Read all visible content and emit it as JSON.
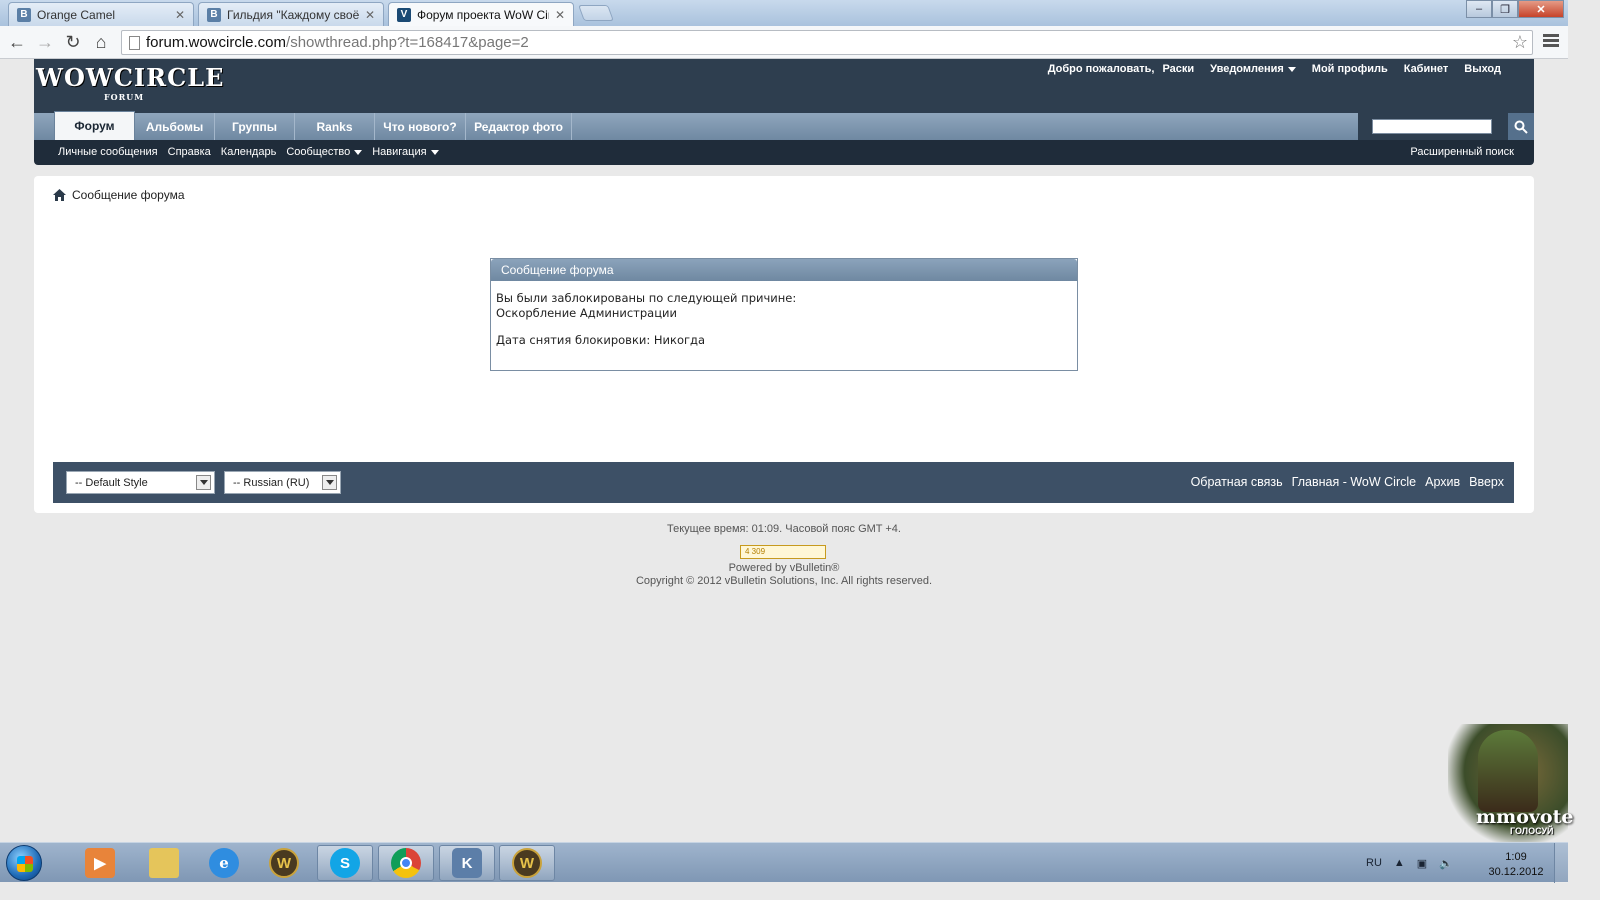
{
  "browser": {
    "tabs": [
      {
        "favicon": "В",
        "title": "Orange Camel"
      },
      {
        "favicon": "В",
        "title": "Гильдия \"Каждому своё\""
      },
      {
        "favicon": "V",
        "title": "Форум проекта WoW Cir"
      }
    ],
    "url_host": "forum.wowcircle.com",
    "url_path": "/showthread.php?t=168417&page=2"
  },
  "forum": {
    "logo": "WOWCIRCLE",
    "logo_sub": "FORUM",
    "toplinks": {
      "welcome": "Добро пожаловать,",
      "user": "Раски",
      "notifications": "Уведомления",
      "profile": "Мой профиль",
      "cabinet": "Кабинет",
      "logout": "Выход"
    },
    "nav_tabs": [
      {
        "label": "Форум",
        "active": true
      },
      {
        "label": "Альбомы"
      },
      {
        "label": "Группы"
      },
      {
        "label": "Ranks"
      },
      {
        "label": "Что нового?"
      },
      {
        "label": "Редактор фото"
      }
    ],
    "subnav": {
      "links": [
        "Личные сообщения",
        "Справка",
        "Календарь"
      ],
      "community": "Сообщество",
      "navigation": "Навигация",
      "advanced_search": "Расширенный поиск"
    },
    "breadcrumb": "Сообщение форума",
    "message": {
      "title": "Сообщение форума",
      "line1": "Вы были заблокированы по следующей причине:",
      "line2": "Оскорбление Администрации",
      "line3": "Дата снятия блокировки: Никогда"
    },
    "footer": {
      "style_select": "-- Default Style",
      "lang_select": "-- Russian (RU)",
      "links": [
        "Обратная связь",
        "Главная - WoW Circle",
        "Архив",
        "Вверх"
      ]
    },
    "time_line": "Текущее время: 01:09. Часовой пояс GMT +4.",
    "counter": "4 309",
    "powered": "Powered by vBulletin®",
    "copyright": "Copyright © 2012 vBulletin Solutions, Inc. All rights reserved."
  },
  "widget": {
    "brand": "mmovote",
    "sub": "ГОЛОСУЙ"
  },
  "taskbar": {
    "lang": "RU",
    "time": "1:09",
    "date": "30.12.2012"
  },
  "colors": {
    "header_bg": "#2e3e4f",
    "nav_bg": "#7d95ae",
    "footer_bar": "#3d5066"
  }
}
